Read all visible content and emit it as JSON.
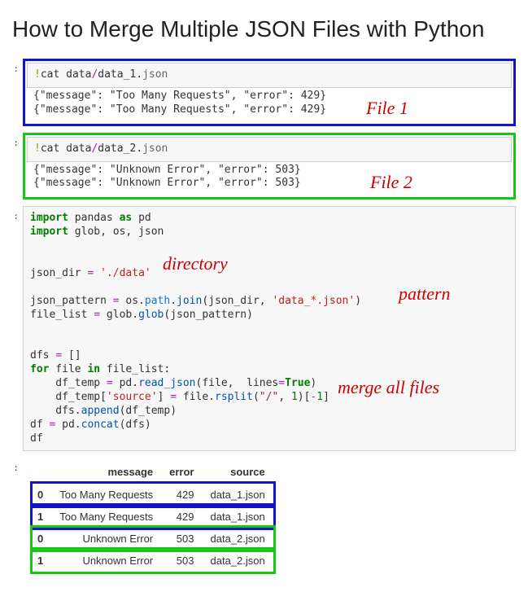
{
  "title": "How to Merge Multiple JSON Files with Python",
  "annotations": {
    "file1": "File 1",
    "file2": "File 2",
    "directory": "directory",
    "pattern": "pattern",
    "merge": "merge all files"
  },
  "cell1": {
    "bang": "!",
    "cat": "cat data",
    "slash": "/",
    "fname": "data_1.",
    "ext": "json",
    "out1": "{\"message\": \"Too Many Requests\", \"error\": 429}",
    "out2": "{\"message\": \"Too Many Requests\", \"error\": 429}"
  },
  "cell2": {
    "bang": "!",
    "cat": "cat data",
    "slash": "/",
    "fname": "data_2.",
    "ext": "json",
    "out1": "{\"message\": \"Unknown Error\", \"error\": 503}",
    "out2": "{\"message\": \"Unknown Error\", \"error\": 503}"
  },
  "cell3": {
    "l1_import": "import",
    "l1_pandas": " pandas ",
    "l1_as": "as",
    "l1_pd": " pd",
    "l2_import": "import",
    "l2_rest": " glob, os, json",
    "l4a": "json_dir ",
    "l4eq": "=",
    "l4b": " ",
    "l4str": "'./data'",
    "l6a": "json_pattern ",
    "l6eq": "=",
    "l6b": " os.",
    "l6path": "path",
    "l6c": ".",
    "l6join": "join",
    "l6d": "(json_dir, ",
    "l6str": "'data_*.json'",
    "l6e": ")",
    "l7a": "file_list ",
    "l7eq": "=",
    "l7b": " glob.",
    "l7glob": "glob",
    "l7c": "(json_pattern)",
    "l9a": "dfs ",
    "l9eq": "=",
    "l9b": " []",
    "l10for": "for",
    "l10a": " file ",
    "l10in": "in",
    "l10b": " file_list:",
    "l11a": "    df_temp ",
    "l11eq": "=",
    "l11b": " pd.",
    "l11read": "read_json",
    "l11c": "(file,  lines",
    "l11eq2": "=",
    "l11true": "True",
    "l11d": ")",
    "l12a": "    df_temp[",
    "l12str": "'source'",
    "l12b": "] ",
    "l12eq": "=",
    "l12c": " file.",
    "l12rsplit": "rsplit",
    "l12d": "(",
    "l12slash": "\"/\"",
    "l12e": ", ",
    "l12one": "1",
    "l12f": ")[",
    "l12neg": "-",
    "l12one2": "1",
    "l12g": "]",
    "l13a": "    dfs.",
    "l13append": "append",
    "l13b": "(df_temp)",
    "l14a": "df ",
    "l14eq": "=",
    "l14b": " pd.",
    "l14concat": "concat",
    "l14c": "(dfs)",
    "l15": "df"
  },
  "table": {
    "cols": [
      "message",
      "error",
      "source"
    ],
    "rows": [
      {
        "idx": "0",
        "message": "Too Many Requests",
        "error": "429",
        "source": "data_1.json",
        "box": "blue"
      },
      {
        "idx": "1",
        "message": "Too Many Requests",
        "error": "429",
        "source": "data_1.json",
        "box": "blue"
      },
      {
        "idx": "0",
        "message": "Unknown Error",
        "error": "503",
        "source": "data_2.json",
        "box": "green"
      },
      {
        "idx": "1",
        "message": "Unknown Error",
        "error": "503",
        "source": "data_2.json",
        "box": "green"
      }
    ]
  }
}
